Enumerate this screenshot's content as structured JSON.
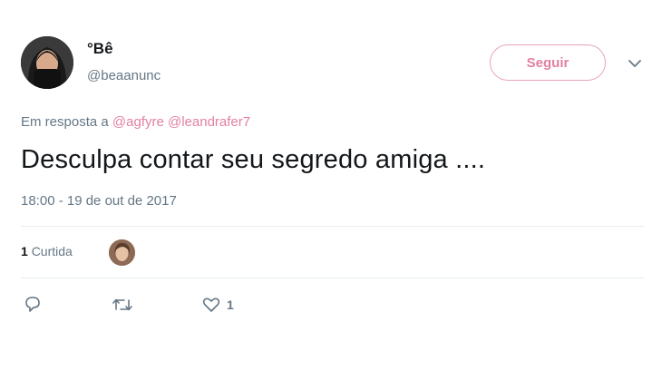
{
  "user": {
    "display_name": "°Bê",
    "handle": "@beaanunc"
  },
  "follow_label": "Seguir",
  "reply_to": {
    "prefix": "Em resposta a",
    "mentions": [
      "@agfyre",
      "@leandrafer7"
    ]
  },
  "tweet": {
    "text": "Desculpa contar seu segredo amiga ....",
    "timestamp": "18:00 - 19 de out de 2017"
  },
  "stats": {
    "likes_number": "1",
    "likes_label": "Curtida"
  },
  "actions": {
    "reply_icon": "reply-icon",
    "retweet_icon": "retweet-icon",
    "like_icon": "heart-icon",
    "like_count": "1"
  },
  "colors": {
    "accent": "#e37fa0",
    "secondary_text": "#657786",
    "divider": "#e6ecf0"
  }
}
